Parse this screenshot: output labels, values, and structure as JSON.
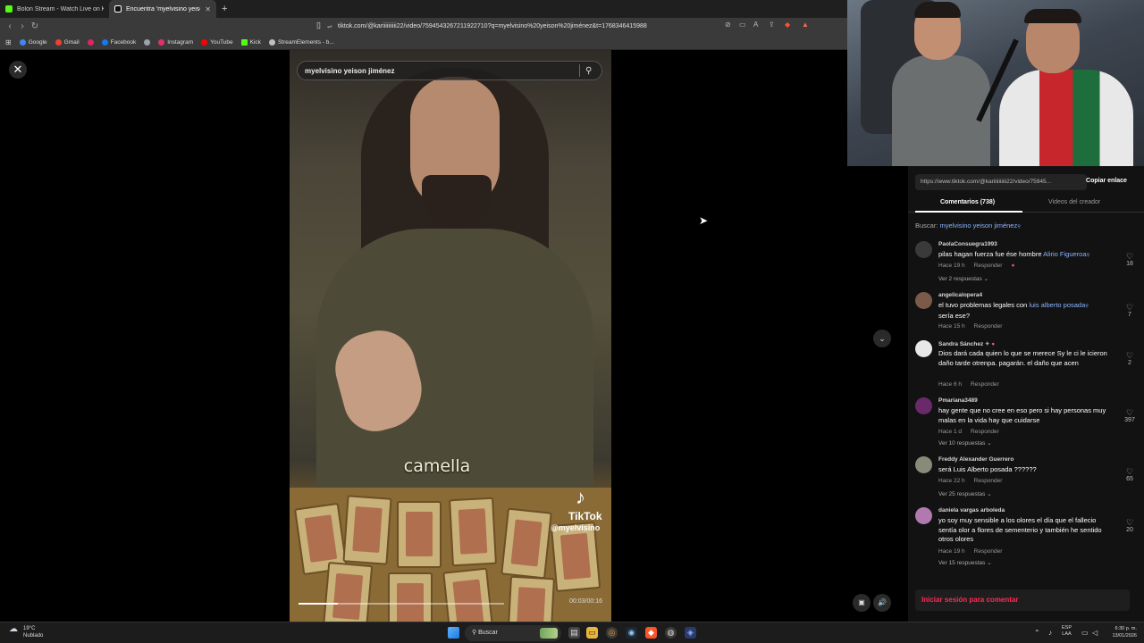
{
  "browser": {
    "tabs": [
      {
        "title": "Bolon Stream - Watch Live on Kick",
        "color": "#53fc18"
      },
      {
        "title": "Encuentra 'myelvisino yeison",
        "color": "#ffffff"
      }
    ],
    "url": "tiktok.com/@kariiiiiiiiii22/video/7594543267211922710?q=myelvisino%20yeison%20jiménez&t=1768346415988",
    "bookmarks": [
      {
        "label": "Google",
        "color": "#4285f4"
      },
      {
        "label": "Gmail",
        "color": "#ea4335"
      },
      {
        "label": "",
        "color": "#e0245e"
      },
      {
        "label": "Facebook",
        "color": "#1877f2"
      },
      {
        "label": "",
        "color": "#9aa4ad"
      },
      {
        "label": "Instagram",
        "color": "#e1306c"
      },
      {
        "label": "YouTube",
        "color": "#ff0000"
      },
      {
        "label": "Kick",
        "color": "#53fc18"
      },
      {
        "label": "StreamElements - b...",
        "color": "#bfbfbf"
      }
    ]
  },
  "video": {
    "search_query": "myelvisino yeison jiménez",
    "caption": "camella",
    "watermark_brand": "TikTok",
    "watermark_user": "@myelvisino",
    "timecode": "00:03/00:16",
    "progress": 0.19
  },
  "panel": {
    "link": "https://www.tiktok.com/@kariiiiiiiiii22/video/75945...",
    "copy_label": "Copiar enlace",
    "tab_comments": "Comentarios (738)",
    "tab_creator": "Videos del creador",
    "search_prefix": "Buscar:",
    "search_keyword": "myelvisino yeison jiménez",
    "comments": [
      {
        "user": "PaolaConsuegra1993",
        "text_before": "pilas hagan fuerza fue ése hombre ",
        "link": "Alirio Figueroa",
        "text_after": "",
        "time": "Hace 19 h",
        "reply": "Responder",
        "replies": "Ver 2 respuestas",
        "likes": "18",
        "avatar_color": "#3a3a3a"
      },
      {
        "user": "angelicalopera4",
        "text_before": "el tuvo problemas legales con ",
        "link": "luis alberto posada",
        "text_after": " sería ese?",
        "time": "Hace 15 h",
        "reply": "Responder",
        "replies": "",
        "likes": "7",
        "avatar_color": "#7a5a48"
      },
      {
        "user": "Sandra Sánchez",
        "text_before": "Dios dará cada quien lo que se merece Sy le ci le icieron daño tarde otrenpa. pagarán. el daño que acen",
        "link": "",
        "text_after": "",
        "time": "Hace 6 h",
        "reply": "Responder",
        "replies": "",
        "likes": "2",
        "avatar_color": "#e8e8e8"
      },
      {
        "user": "Pmariana3489",
        "text_before": "hay gente que no cree en eso pero si hay personas muy malas en la vida hay que cuidarse",
        "link": "",
        "text_after": "",
        "time": "Hace 1 d",
        "reply": "Responder",
        "replies": "Ver 10 respuestas",
        "likes": "397",
        "avatar_color": "#6a2a6a"
      },
      {
        "user": "Freddy Alexander Guerrero",
        "text_before": "será Luis Alberto posada ??????",
        "link": "",
        "text_after": "",
        "time": "Hace 22 h",
        "reply": "Responder",
        "replies": "Ver 25 respuestas",
        "likes": "65",
        "avatar_color": "#8a8a7a"
      },
      {
        "user": "daniela vargas arboleda",
        "text_before": "yo soy muy sensible a los olores el día que el fallecio sentía olor a flores de sementerio y también he sentido otros olores",
        "link": "",
        "text_after": "",
        "time": "Hace 19 h",
        "reply": "Responder",
        "replies": "Ver 15 respuestas",
        "likes": "20",
        "avatar_color": "#b07ab0"
      }
    ],
    "login_cta": "Iniciar sesión para comentar"
  },
  "taskbar": {
    "temp": "19°C",
    "weather": "Nublado",
    "search": "Buscar",
    "lang1": "ESP",
    "lang2": "LAA",
    "time": "6:30 p. m.",
    "date": "13/01/2026"
  }
}
